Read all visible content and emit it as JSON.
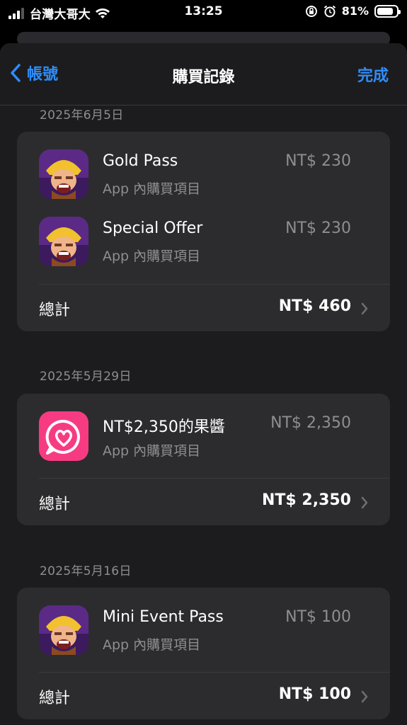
{
  "status_bar": {
    "carrier": "台灣大哥大",
    "time": "13:25",
    "battery": "81%",
    "battery_level": 0.81
  },
  "nav": {
    "back_label": "帳號",
    "title": "購買記錄",
    "done_label": "完成"
  },
  "sections": [
    {
      "date": "2025年6月5日",
      "items": [
        {
          "name": "Gold Pass",
          "type": "App 內購買項目",
          "price": "NT$ 230",
          "icon": "clash-of-clans-icon"
        },
        {
          "name": "Special Offer",
          "type": "App 內購買項目",
          "price": "NT$ 230",
          "icon": "clash-of-clans-icon"
        }
      ],
      "total_label": "總計",
      "total": "NT$ 460"
    },
    {
      "date": "2025年5月29日",
      "items": [
        {
          "name": "NT$2,350的果醬",
          "type": "App 內購買項目",
          "price": "NT$ 2,350",
          "icon": "heart-chat-app-icon"
        }
      ],
      "total_label": "總計",
      "total": "NT$ 2,350"
    },
    {
      "date": "2025年5月16日",
      "items": [
        {
          "name": "Mini Event Pass",
          "type": "App 內購買項目",
          "price": "NT$ 100",
          "icon": "clash-of-clans-icon"
        }
      ],
      "total_label": "總計",
      "total": "NT$ 100"
    }
  ],
  "colors": {
    "accent": "#2f8df8",
    "background": "#1c1c1e",
    "card": "#2c2c2e",
    "secondary_text": "#8e8e93"
  }
}
